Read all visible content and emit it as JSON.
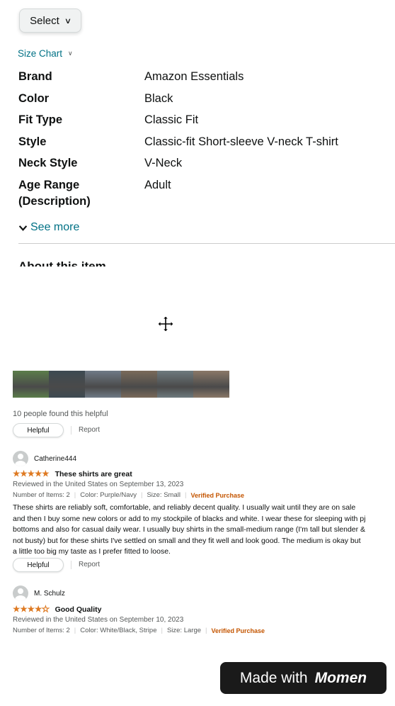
{
  "select": {
    "label": "Select"
  },
  "size_chart": {
    "label": "Size Chart"
  },
  "specs": [
    {
      "key": "Brand",
      "value": "Amazon Essentials"
    },
    {
      "key": "Color",
      "value": "Black"
    },
    {
      "key": "Fit Type",
      "value": "Classic Fit"
    },
    {
      "key": "Style",
      "value": "Classic-fit Short-sleeve V-neck T-shirt"
    },
    {
      "key": "Neck Style",
      "value": "V-Neck"
    },
    {
      "key": "Age Range",
      "key2": "(Description)",
      "value": "Adult"
    }
  ],
  "see_more": {
    "label": "See more"
  },
  "about": {
    "heading": "About this item"
  },
  "thumbnails": {
    "colors": [
      "#5b7d4a",
      "#3d4a52",
      "#6f7a86",
      "#7a6a5a",
      "#6e7a7e",
      "#8a7868"
    ]
  },
  "first_review_footer": {
    "helpful_count": "10 people found this helpful",
    "helpful_label": "Helpful",
    "report_label": "Report"
  },
  "reviews": [
    {
      "name": "Catherine444",
      "rating": 5,
      "title": "These shirts are great",
      "reviewed": "Reviewed in the United States on September 13, 2023",
      "items": "Number of Items: 2",
      "color": "Color: Purple/Navy",
      "size": "Size: Small",
      "verified": "Verified Purchase",
      "body": "These shirts are reliably soft, comfortable, and reliably decent quality. I usually wait until they are on sale and then I buy some new colors or add to my stockpile of blacks and white. I wear these for sleeping with pj bottoms and also for casual daily wear. I usually buy shirts in the small-medium range (I'm tall but slender & not busty) but for these shirts I've settled on small and they fit well and look good. The medium is okay but a little too big my taste as I prefer fitted to loose.",
      "helpful_label": "Helpful",
      "report_label": "Report"
    },
    {
      "name": "M. Schulz",
      "rating": 4,
      "title": "Good Quality",
      "reviewed": "Reviewed in the United States on September 10, 2023",
      "items": "Number of Items: 2",
      "color": "Color: White/Black, Stripe",
      "size": "Size: Large",
      "verified": "Verified Purchase"
    }
  ],
  "badge": {
    "prefix": "Made with",
    "brand": "Momen"
  },
  "colors": {
    "link": "#007185",
    "star": "#de7921",
    "verified": "#c45500"
  }
}
